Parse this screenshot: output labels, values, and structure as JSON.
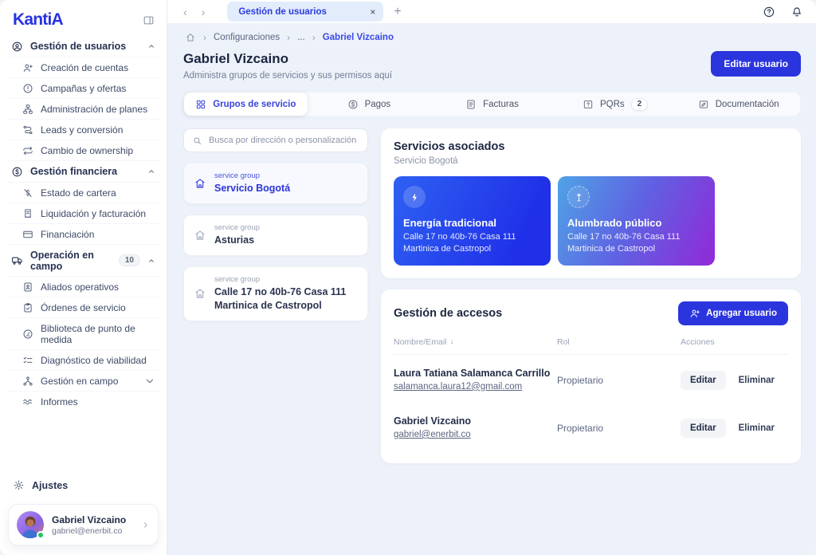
{
  "colors": {
    "accent": "#2b35dd",
    "link": "#3848e8",
    "energia_gradient": [
      "#2e61f2",
      "#2030e8"
    ],
    "alumbrado_gradient": [
      "#4fa3e6",
      "#9129d8"
    ]
  },
  "icons": {
    "back": "‹",
    "forward": "›",
    "close": "×",
    "new_tab": "+",
    "breadcrumb_sep": "›",
    "sort_desc": "↓"
  },
  "sidebar": {
    "logo": "KantiA",
    "sections": [
      {
        "label": "Gestión de usuarios",
        "items": [
          {
            "label": "Creación de cuentas"
          },
          {
            "label": "Campañas y ofertas"
          },
          {
            "label": "Administración de planes"
          },
          {
            "label": "Leads y conversión"
          },
          {
            "label": "Cambio de ownership"
          }
        ]
      },
      {
        "label": "Gestión financiera",
        "items": [
          {
            "label": "Estado de cartera"
          },
          {
            "label": "Liquidación y facturación"
          },
          {
            "label": "Financiación"
          }
        ]
      },
      {
        "label": "Operación en campo",
        "badge": "10",
        "items": [
          {
            "label": "Aliados operativos"
          },
          {
            "label": "Órdenes de servicio"
          },
          {
            "label": "Biblioteca de punto de medida"
          },
          {
            "label": "Diagnóstico de viabilidad"
          },
          {
            "label": "Gestión en campo"
          },
          {
            "label": "Informes"
          }
        ]
      }
    ],
    "settings_label": "Ajustes",
    "user": {
      "name": "Gabriel Vizcaino",
      "email": "gabriel@enerbit.co"
    }
  },
  "tabstrip": {
    "tab_label": "Gestión de usuarios"
  },
  "breadcrumb": {
    "items": [
      "Configuraciones",
      "...",
      "Gabriel Vizcaino"
    ]
  },
  "header": {
    "title": "Gabriel Vizcaino",
    "subtitle": "Administra grupos de servicios y sus permisos aquí",
    "edit_button": "Editar usuario"
  },
  "tabs": [
    {
      "label": "Grupos de servicio"
    },
    {
      "label": "Pagos"
    },
    {
      "label": "Facturas"
    },
    {
      "label": "PQRs",
      "badge": "2"
    },
    {
      "label": "Documentación"
    }
  ],
  "search": {
    "placeholder": "Busca por dirección o personalización"
  },
  "service_groups": {
    "type_label": "service group",
    "items": [
      {
        "name": "Servicio Bogotá"
      },
      {
        "name": "Asturias"
      },
      {
        "name": "Calle 17 no 40b-76 Casa 111 Martinica de Castropol"
      }
    ]
  },
  "services": {
    "title": "Servicios asociados",
    "subtitle": "Servicio Bogotá",
    "cards": [
      {
        "name": "Energía tradicional",
        "address1": "Calle 17 no 40b-76 Casa 111",
        "address2": "Martinica de Castropol"
      },
      {
        "name": "Alumbrado público",
        "address1": "Calle 17 no 40b-76 Casa 111",
        "address2": "Martinica de Castropol"
      }
    ]
  },
  "access": {
    "title": "Gestión de accesos",
    "add_button": "Agregar usuario",
    "columns": [
      "Nombre/Email",
      "Rol",
      "Acciones"
    ],
    "rows": [
      {
        "name": "Laura Tatiana Salamanca Carrillo",
        "email": "salamanca.laura12@gmail.com",
        "role": "Propietario",
        "edit": "Editar",
        "delete": "Eliminar"
      },
      {
        "name": "Gabriel Vizcaino",
        "email": "gabriel@enerbit.co",
        "role": "Propietario",
        "edit": "Editar",
        "delete": "Eliminar"
      }
    ]
  }
}
